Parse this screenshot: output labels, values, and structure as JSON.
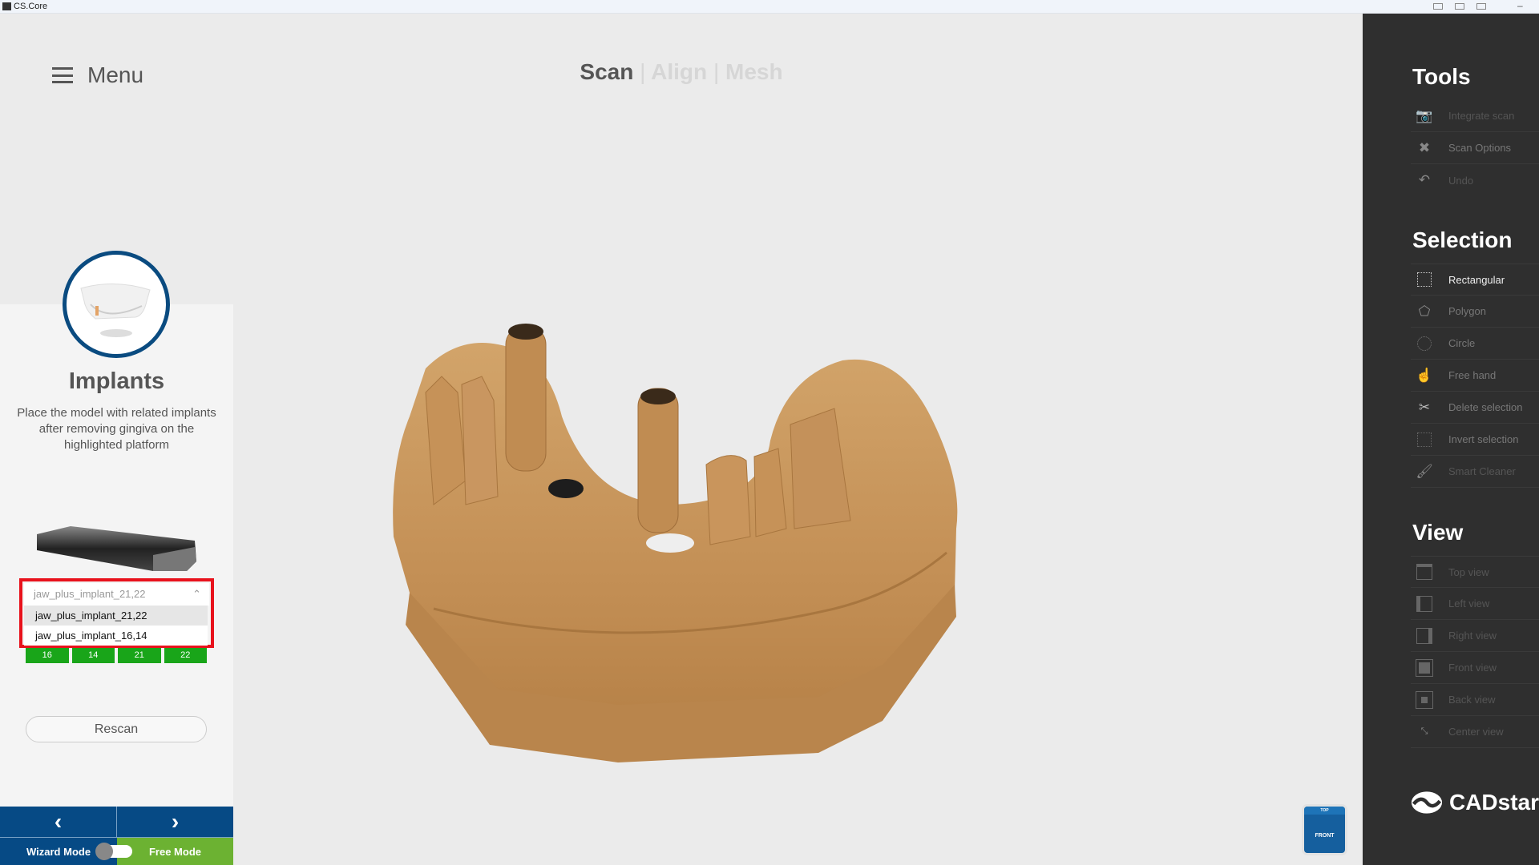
{
  "window": {
    "title": "CS.Core"
  },
  "menu": {
    "label": "Menu",
    "icon": "hamburger-icon"
  },
  "steps": [
    {
      "label": "Scan",
      "active": true
    },
    {
      "label": "Align",
      "active": false
    },
    {
      "label": "Mesh",
      "active": false
    }
  ],
  "step_sep": "|",
  "wizard": {
    "title": "Implants",
    "description": "Place the model with related implants after removing gingiva on the highlighted platform"
  },
  "dropdown": {
    "selected": "jaw_plus_implant_21,22",
    "options": [
      "jaw_plus_implant_21,22",
      "jaw_plus_implant_16,14"
    ]
  },
  "teeth": [
    "16",
    "14",
    "21",
    "22"
  ],
  "rescan_label": "Rescan",
  "nav": {
    "prev": "‹",
    "next": "›"
  },
  "modes": {
    "wizard": "Wizard Mode",
    "free": "Free Mode",
    "active": "free"
  },
  "tools": {
    "title": "Tools",
    "items": [
      {
        "label": "Integrate scan",
        "icon": "camera-plus-icon"
      },
      {
        "label": "Scan Options",
        "icon": "tools-icon"
      },
      {
        "label": "Undo",
        "icon": "undo-icon"
      }
    ]
  },
  "selection": {
    "title": "Selection",
    "items": [
      {
        "label": "Rectangular",
        "icon": "rect-select-icon"
      },
      {
        "label": "Polygon",
        "icon": "polygon-select-icon"
      },
      {
        "label": "Circle",
        "icon": "circle-select-icon"
      },
      {
        "label": "Free hand",
        "icon": "freehand-select-icon"
      },
      {
        "label": "Delete selection",
        "icon": "scissors-icon"
      },
      {
        "label": "Invert selection",
        "icon": "invert-select-icon"
      },
      {
        "label": "Smart Cleaner",
        "icon": "brush-icon"
      }
    ]
  },
  "view": {
    "title": "View",
    "items": [
      {
        "label": "Top view",
        "icon": "top-view-icon"
      },
      {
        "label": "Left view",
        "icon": "left-view-icon"
      },
      {
        "label": "Right view",
        "icon": "right-view-icon"
      },
      {
        "label": "Front view",
        "icon": "front-view-icon"
      },
      {
        "label": "Back view",
        "icon": "back-view-icon"
      },
      {
        "label": "Center view",
        "icon": "center-view-icon"
      }
    ]
  },
  "brand": {
    "logo_text": "CADstar"
  },
  "cube": {
    "top": "TOP",
    "face": "FRONT"
  },
  "colors": {
    "accent": "#064a85",
    "free_mode": "#6cb232",
    "tooth": "#19a519",
    "highlight": "#e8121c",
    "model": "#c8995f"
  }
}
